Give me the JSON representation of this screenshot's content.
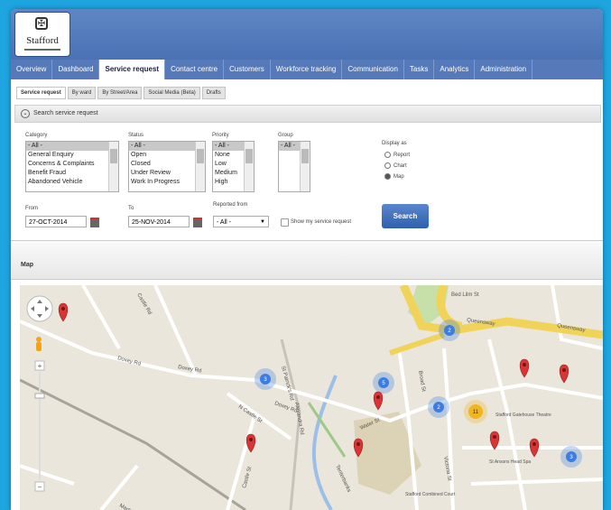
{
  "logo": {
    "text": "Stafford"
  },
  "nav": {
    "tabs": [
      {
        "label": "Overview",
        "active": false
      },
      {
        "label": "Dashboard",
        "active": false
      },
      {
        "label": "Service request",
        "active": true
      },
      {
        "label": "Contact centre",
        "active": false
      },
      {
        "label": "Customers",
        "active": false
      },
      {
        "label": "Workforce tracking",
        "active": false
      },
      {
        "label": "Communication",
        "active": false
      },
      {
        "label": "Tasks",
        "active": false
      },
      {
        "label": "Analytics",
        "active": false
      },
      {
        "label": "Administration",
        "active": false
      }
    ]
  },
  "subtabs": [
    {
      "label": "Service request",
      "active": true
    },
    {
      "label": "By ward",
      "active": false
    },
    {
      "label": "By Street/Area",
      "active": false
    },
    {
      "label": "Social Media (Beta)",
      "active": false
    },
    {
      "label": "Drafts",
      "active": false
    }
  ],
  "search": {
    "title": "Search service request",
    "category_label": "Category",
    "category_options": [
      "- All -",
      "General Enquiry",
      "Concerns & Complaints",
      "Benefit Fraud",
      "Abandoned Vehicle"
    ],
    "status_label": "Status",
    "status_options": [
      "- All -",
      "Open",
      "Closed",
      "Under Review",
      "Work In Progress"
    ],
    "priority_label": "Priority",
    "priority_options": [
      "- All -",
      "None",
      "Low",
      "Medium",
      "High"
    ],
    "group_label": "Group",
    "group_options": [
      "- All -"
    ],
    "display_label": "Display as",
    "display_options": [
      {
        "label": "Report",
        "selected": false
      },
      {
        "label": "Chart",
        "selected": false
      },
      {
        "label": "Map",
        "selected": true
      }
    ],
    "from_label": "From",
    "from_value": "27-OCT-2014",
    "to_label": "To",
    "to_value": "25-NOV-2014",
    "reported_label": "Reported from",
    "reported_value": "- All -",
    "show_mine_label": "Show my service request",
    "button_label": "Search"
  },
  "map": {
    "title": "Map",
    "roads": [
      "Doxey Rd",
      "Doxey Rd",
      "Doxey Rd",
      "N Castle St",
      "Castle St",
      "Queensway",
      "Queensway",
      "Bed Lilm St",
      "Broad St",
      "Water St",
      "St Patrick's Rd",
      "Victoria St",
      "Martin Dr",
      "Alexandra Rd",
      "Castle Rd",
      "Tenterbanks",
      "Stafford Gatehouse Theatre",
      "St Ansons Head Spa",
      "Stafford Combined Court"
    ],
    "clusters": [
      {
        "count": "2"
      },
      {
        "count": "3"
      },
      {
        "count": "5"
      },
      {
        "count": "2"
      },
      {
        "count": "11"
      },
      {
        "count": "3"
      }
    ],
    "colors": {
      "pin": "#d93535",
      "cluster": "#3d7de0",
      "cluster_big": "#f0b520",
      "road_main": "#f1d35a",
      "water": "#9bbfe6",
      "park": "#c7dfa8"
    }
  }
}
